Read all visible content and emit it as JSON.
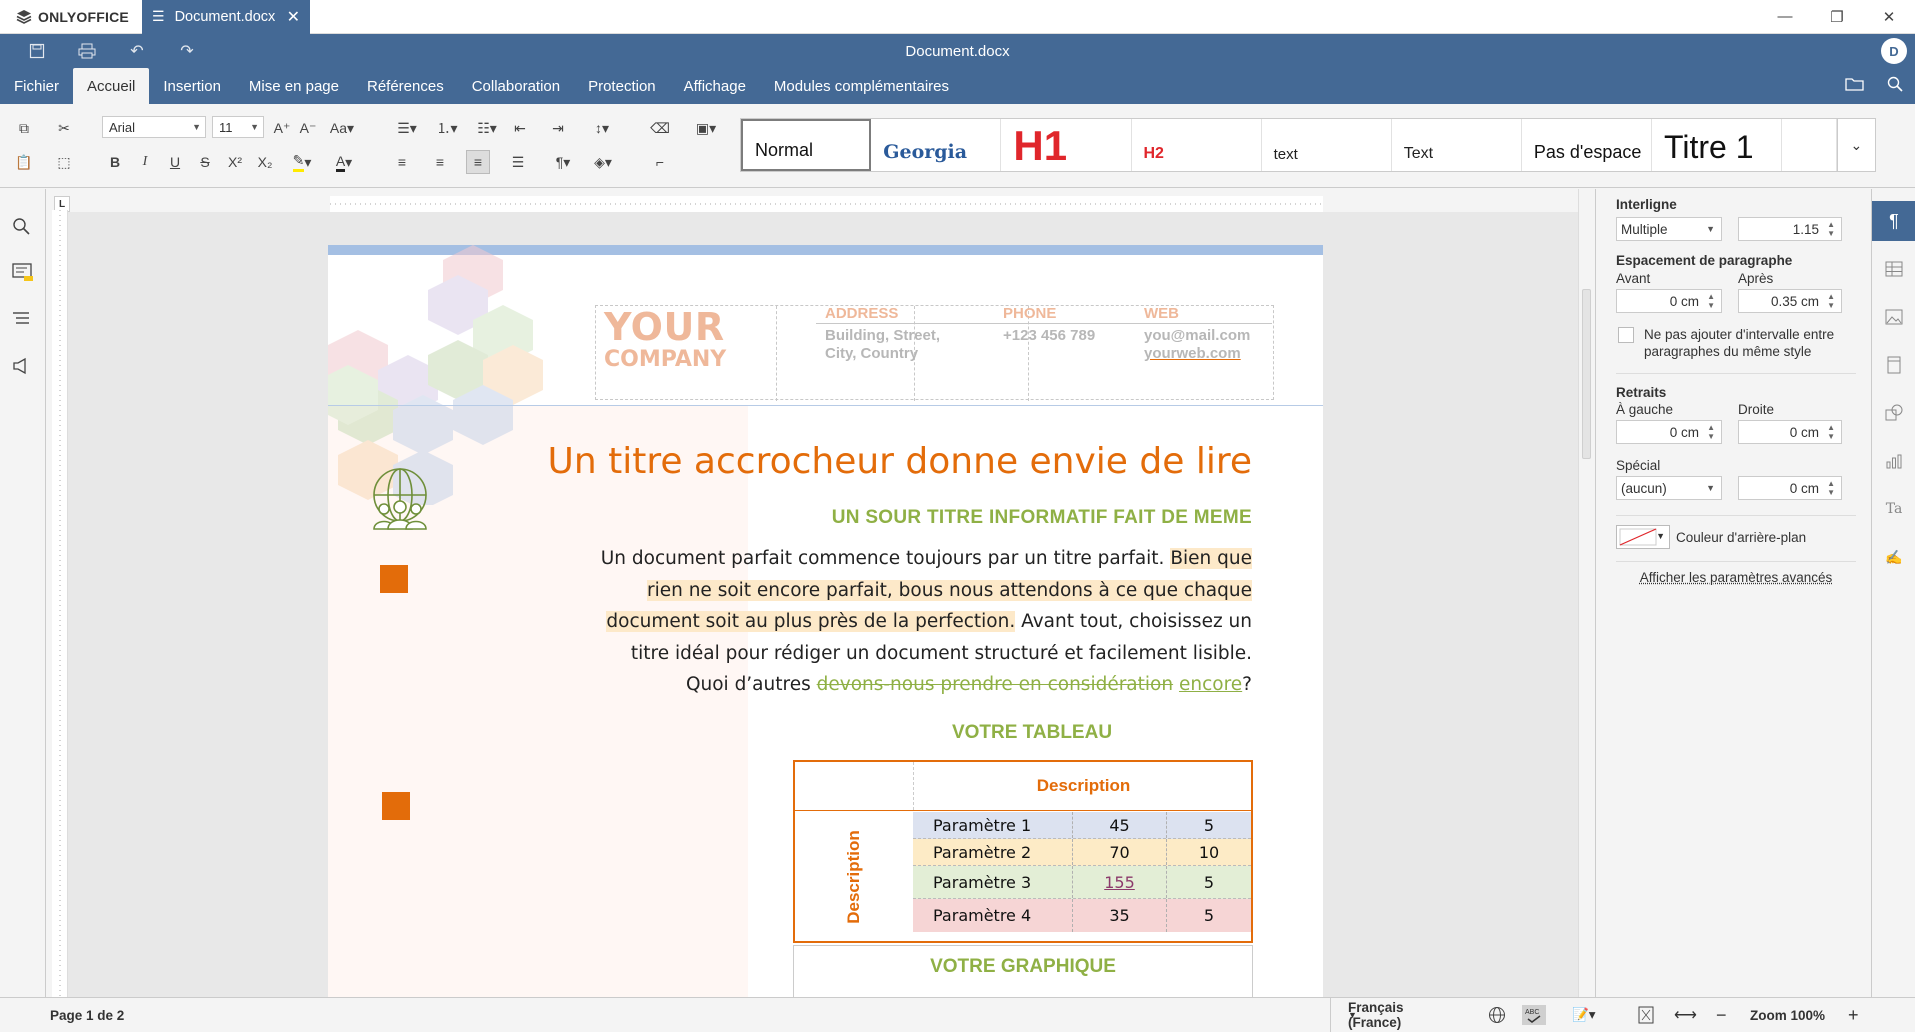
{
  "app": {
    "name": "ONLYOFFICE",
    "tab_name": "Document.docx",
    "title": "Document.docx",
    "user_initial": "D"
  },
  "menu": {
    "tabs": [
      "Fichier",
      "Accueil",
      "Insertion",
      "Mise en page",
      "Références",
      "Collaboration",
      "Protection",
      "Affichage",
      "Modules complémentaires"
    ],
    "active": "Accueil"
  },
  "toolbar": {
    "font": "Arial",
    "size": "11"
  },
  "styles": [
    {
      "label": "Normal",
      "selected": true
    },
    {
      "label": "Georgia"
    },
    {
      "label": "H1"
    },
    {
      "label": "H2"
    },
    {
      "label": "text"
    },
    {
      "label": "Text"
    },
    {
      "label": "Pas d'espace"
    },
    {
      "label": "Titre 1"
    },
    {
      "label": ""
    }
  ],
  "document": {
    "company_line1": "YOUR",
    "company_line2": "COMPANY",
    "address_label": "ADDRESS",
    "address_value_1": "Building, Street,",
    "address_value_2": "City, Country",
    "phone_label": "PHONE",
    "phone_value": "+123 456 789",
    "web_label": "WEB",
    "web_email": "you@mail.com",
    "web_url": "yourweb.com",
    "title": "Un titre accrocheur donne envie de lire",
    "subtitle": "UN SOUR TITRE INFORMATIF FAIT DE MEME",
    "paragraph": {
      "p1": "Un document parfait commence toujours par un titre parfait.",
      "p2": "Bien que rien ne soit encore parfait, bous nous attendons à ce que chaque document soit au plus près de la perfection.",
      "p3": "Avant tout, choisissez un titre idéal pour rédiger un document structuré et facilement lisible. Quoi d’autres",
      "p4_deleted": "devons-nous prendre en considération",
      "p5_inserted": "encore",
      "p6": "?"
    },
    "table_title": "VOTRE TABLEAU",
    "table": {
      "header": "Description",
      "side_header": "Description",
      "rows": [
        {
          "name": "Paramètre 1",
          "v1": "45",
          "v2": "5",
          "color": "#dce2f0"
        },
        {
          "name": "Paramètre 2",
          "v1": "70",
          "v2": "10",
          "color": "#fdebc6"
        },
        {
          "name": "Paramètre 3",
          "v1": "155",
          "v2": "5",
          "color": "#e3eed6"
        },
        {
          "name": "Paramètre 4",
          "v1": "35",
          "v2": "5",
          "color": "#f6d5d5"
        }
      ]
    },
    "graph_title": "VOTRE GRAPHIQUE"
  },
  "right_panel": {
    "line_spacing_label": "Interligne",
    "line_spacing_mode": "Multiple",
    "line_spacing_value": "1.15",
    "para_spacing_label": "Espacement de paragraphe",
    "before_label": "Avant",
    "before_value": "0 cm",
    "after_label": "Après",
    "after_value": "0.35 cm",
    "no_interval_checkbox": "Ne pas ajouter d'intervalle entre paragraphes du même style",
    "indents_label": "Retraits",
    "left_label": "À gauche",
    "left_value": "0 cm",
    "right_label": "Droite",
    "right_value": "0 cm",
    "special_label": "Spécial",
    "special_mode": "(aucun)",
    "special_value": "0 cm",
    "bg_color_label": "Couleur d'arrière-plan",
    "advanced_link": "Afficher les paramètres avancés"
  },
  "status": {
    "page": "Page 1 de 2",
    "language": "Français (France)",
    "zoom": "Zoom 100%"
  },
  "colors": {
    "accent": "#446995",
    "orange": "#e36c0a",
    "green": "#8fb045",
    "peach": "#efb89a"
  }
}
